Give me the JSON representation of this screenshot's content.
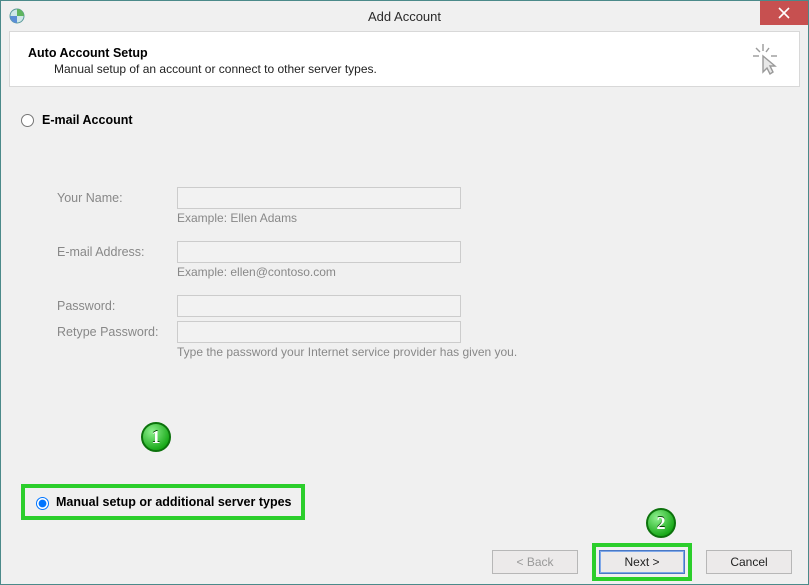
{
  "titlebar": {
    "title": "Add Account"
  },
  "header": {
    "heading": "Auto Account Setup",
    "subheading": "Manual setup of an account or connect to other server types."
  },
  "radios": {
    "email_label": "E-mail Account",
    "manual_label": "Manual setup or additional server types"
  },
  "form": {
    "your_name": {
      "label": "Your Name:",
      "value": "",
      "hint": "Example: Ellen Adams"
    },
    "email": {
      "label": "E-mail Address:",
      "value": "",
      "hint": "Example: ellen@contoso.com"
    },
    "password": {
      "label": "Password:",
      "value": ""
    },
    "retype": {
      "label": "Retype Password:",
      "value": "",
      "hint": "Type the password your Internet service provider has given you."
    }
  },
  "buttons": {
    "back": "< Back",
    "next": "Next >",
    "cancel": "Cancel"
  },
  "annotations": {
    "one": "1",
    "two": "2"
  }
}
